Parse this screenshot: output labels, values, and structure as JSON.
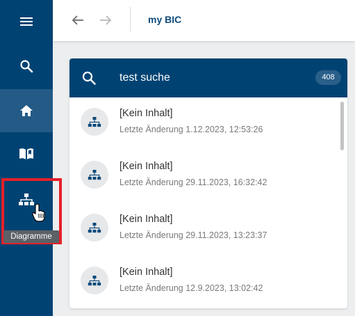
{
  "sidebar": {
    "items": [
      {
        "name": "menu",
        "icon": "hamburger-menu-icon"
      },
      {
        "name": "search",
        "icon": "search-icon"
      },
      {
        "name": "home",
        "icon": "home-icon",
        "active": true
      },
      {
        "name": "catalog",
        "icon": "open-book-icon"
      },
      {
        "name": "diagrams",
        "icon": "sitemap-icon",
        "hovered": true
      }
    ],
    "tooltip": "Diagramme"
  },
  "topbar": {
    "back_icon": "arrow-left-icon",
    "forward_icon": "arrow-right-icon",
    "breadcrumb": "my BIC"
  },
  "search": {
    "value": "test suche",
    "count": "408"
  },
  "results": [
    {
      "title": "[Kein Inhalt]",
      "subtitle": "Letzte Änderung 1.12.2023, 12:53:26",
      "icon": "sitemap-icon"
    },
    {
      "title": "[Kein Inhalt]",
      "subtitle": "Letzte Änderung 29.11.2023, 16:32:42",
      "icon": "sitemap-icon"
    },
    {
      "title": "[Kein Inhalt]",
      "subtitle": "Letzte Änderung 29.11.2023, 13:23:37",
      "icon": "sitemap-icon"
    },
    {
      "title": "[Kein Inhalt]",
      "subtitle": "Letzte Änderung 12.9.2023, 13:02:42",
      "icon": "sitemap-icon"
    }
  ],
  "colors": {
    "sidebar_bg": "#004373",
    "sidebar_active": "#235a86",
    "highlight": "#e5202a",
    "breadcrumb": "#0e4a7b",
    "result_icon": "#0e4a7b"
  }
}
